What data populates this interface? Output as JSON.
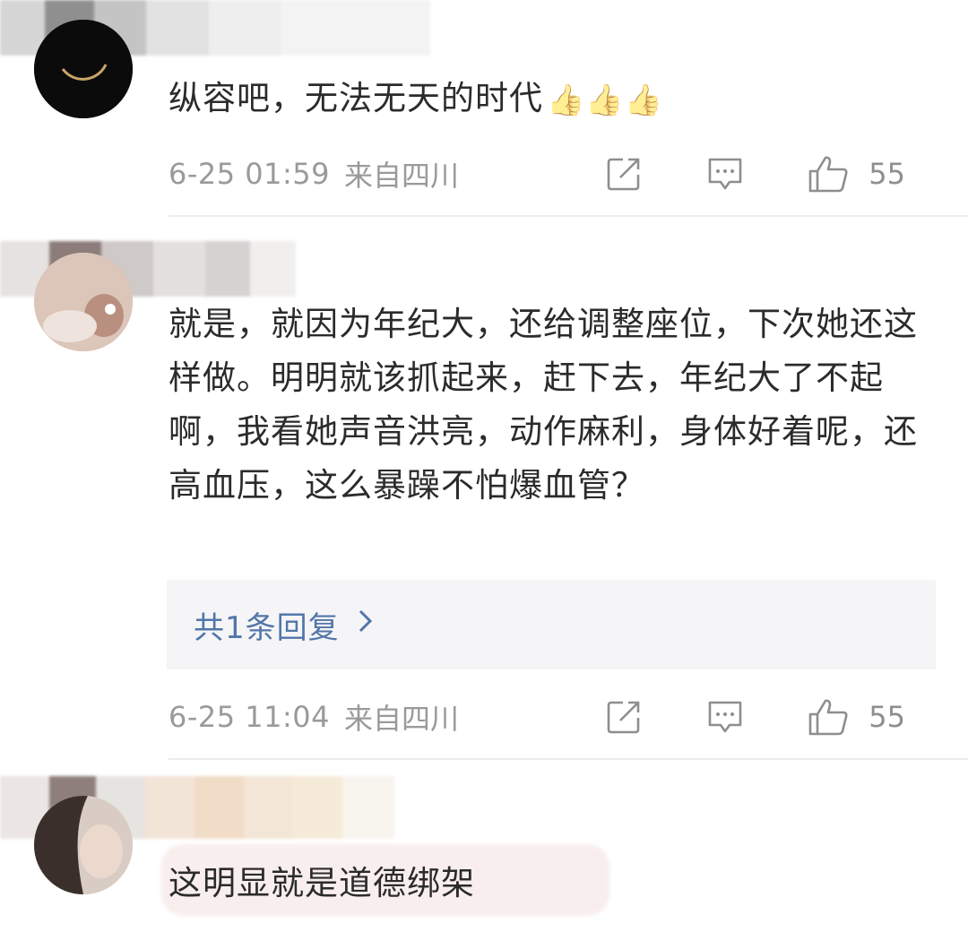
{
  "comments": [
    {
      "text": "纵容吧，无法无天的时代",
      "emoji": [
        "👍",
        "👍",
        "👍"
      ],
      "emoji_name": "thumbs-up",
      "time": "6-25 01:59",
      "location": "来自四川",
      "likes": "55"
    },
    {
      "text": "就是，就因为年纪大，还给调整座位，下次她还这样做。明明就该抓起来，赶下去，年纪大了不起啊，我看她声音洪亮，动作麻利，身体好着呢，还高血压，这么暴躁不怕爆血管？",
      "replies_label": "共1条回复",
      "time": "6-25 11:04",
      "location": "来自四川",
      "likes": "55"
    },
    {
      "text": "这明显就是道德绑架"
    }
  ],
  "icons": {
    "share": "share-icon",
    "reply": "comment-icon",
    "like": "thumbs-up-icon",
    "chevron": "chevron-right-icon"
  },
  "colors": {
    "text": "#2b2b2b",
    "meta": "#9a9a9a",
    "link": "#5276a8",
    "reply_bg": "#f5f5f7",
    "divider": "#ececec"
  }
}
